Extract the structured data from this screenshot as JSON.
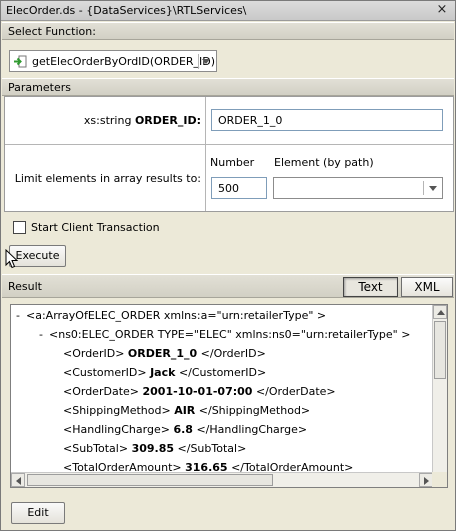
{
  "window": {
    "title": "ElecOrder.ds - {DataServices}\\RTLServices\\",
    "close_glyph": "×"
  },
  "select_function": {
    "header": "Select Function:",
    "selected": "getElecOrderByOrdID(ORDER_ID)",
    "icon": "function-arrow-icon"
  },
  "parameters": {
    "header": "Parameters",
    "order_id": {
      "type_prefix": "xs:string ",
      "name": "ORDER_ID:",
      "value": "ORDER_1_0"
    },
    "limit": {
      "label": "Limit elements in array results to:",
      "number_label": "Number",
      "number_value": "500",
      "element_label": "Element (by path)",
      "element_value": ""
    }
  },
  "transaction": {
    "label": "Start Client Transaction",
    "checked": false
  },
  "execute_label": "Execute",
  "result": {
    "header": "Result",
    "tabs": {
      "text": "Text",
      "xml": "XML"
    },
    "active_tab": "Text",
    "tree": [
      {
        "toggle": "-",
        "indent": 0,
        "open": "<a:ArrayOfELEC_ORDER xmlns:a=\"urn:retailerType\" >",
        "value": "",
        "close": ""
      },
      {
        "toggle": "-",
        "indent": 1,
        "open": "<ns0:ELEC_ORDER TYPE=\"ELEC\" xmlns:ns0=\"urn:retailerType\" >",
        "value": "",
        "close": ""
      },
      {
        "toggle": "",
        "indent": 2,
        "open": "<OrderID>",
        "value": "ORDER_1_0",
        "close": "</OrderID>"
      },
      {
        "toggle": "",
        "indent": 2,
        "open": "<CustomerID>",
        "value": "Jack",
        "close": "</CustomerID>"
      },
      {
        "toggle": "",
        "indent": 2,
        "open": "<OrderDate>",
        "value": "2001-10-01-07:00",
        "close": "</OrderDate>"
      },
      {
        "toggle": "",
        "indent": 2,
        "open": "<ShippingMethod>",
        "value": "AIR",
        "close": "</ShippingMethod>"
      },
      {
        "toggle": "",
        "indent": 2,
        "open": "<HandlingCharge>",
        "value": "6.8",
        "close": "</HandlingCharge>"
      },
      {
        "toggle": "",
        "indent": 2,
        "open": "<SubTotal>",
        "value": "309.85",
        "close": "</SubTotal>"
      },
      {
        "toggle": "",
        "indent": 2,
        "open": "<TotalOrderAmount>",
        "value": "316.65",
        "close": "</TotalOrderAmount>"
      }
    ]
  },
  "edit_label": "Edit"
}
